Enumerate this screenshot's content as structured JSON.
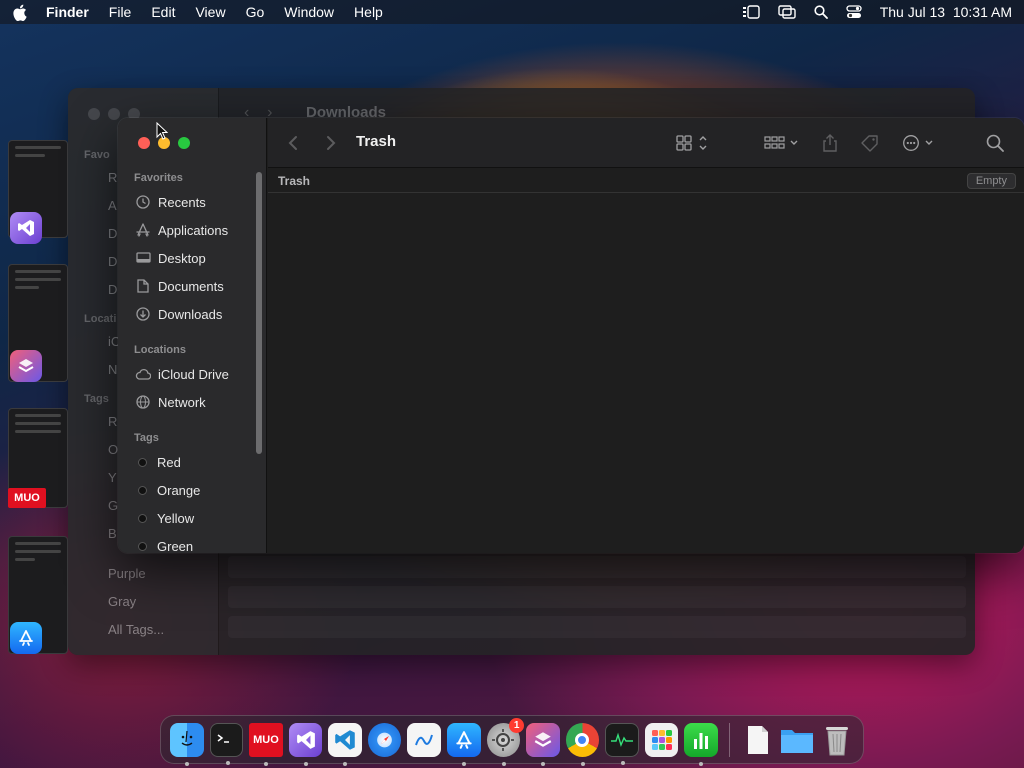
{
  "menubar": {
    "app_name": "Finder",
    "menus": [
      "File",
      "Edit",
      "View",
      "Go",
      "Window",
      "Help"
    ],
    "clock": "Thu Jul 13  10:31 AM"
  },
  "background_window": {
    "title": "Downloads",
    "sidebar_head": "Favo",
    "sidebar_letters": [
      "R",
      "A",
      "D",
      "D",
      "D"
    ],
    "locations_head": "Locati",
    "locations_letters": [
      "iC",
      "N"
    ],
    "tags_head": "Tags",
    "tags_letters": [
      "R",
      "O",
      "Y",
      "G",
      "B"
    ],
    "tags": [
      "Purple",
      "Gray",
      "All Tags..."
    ]
  },
  "stage_manager": {
    "mud_badge": "MUO"
  },
  "finder": {
    "title": "Trash",
    "path_label": "Trash",
    "empty_button": "Empty",
    "sidebar": {
      "favorites_label": "Favorites",
      "favorites": [
        {
          "label": "Recents",
          "icon": "clock-icon"
        },
        {
          "label": "Applications",
          "icon": "applications-icon"
        },
        {
          "label": "Desktop",
          "icon": "desktop-icon"
        },
        {
          "label": "Documents",
          "icon": "document-icon"
        },
        {
          "label": "Downloads",
          "icon": "download-icon"
        }
      ],
      "locations_label": "Locations",
      "locations": [
        {
          "label": "iCloud Drive",
          "icon": "cloud-icon"
        },
        {
          "label": "Network",
          "icon": "globe-icon"
        }
      ],
      "tags_label": "Tags",
      "tags": [
        "Red",
        "Orange",
        "Yellow",
        "Green"
      ]
    }
  },
  "dock": {
    "mud_label": "MUO",
    "settings_badge": "1",
    "apps": [
      "finder-icon",
      "terminal-icon",
      "muo-icon",
      "visual-studio-icon",
      "vscode-icon",
      "safari-icon",
      "freeform-icon",
      "app-store-icon",
      "system-settings-icon",
      "shortcuts-icon",
      "chrome-icon",
      "activity-monitor-icon",
      "launchpad-icon",
      "numbers-icon",
      "document-icon",
      "folder-icon",
      "trash-icon"
    ]
  },
  "colors": {
    "close": "#ff5f57",
    "minimize": "#febc2e",
    "maximize": "#28c840"
  }
}
